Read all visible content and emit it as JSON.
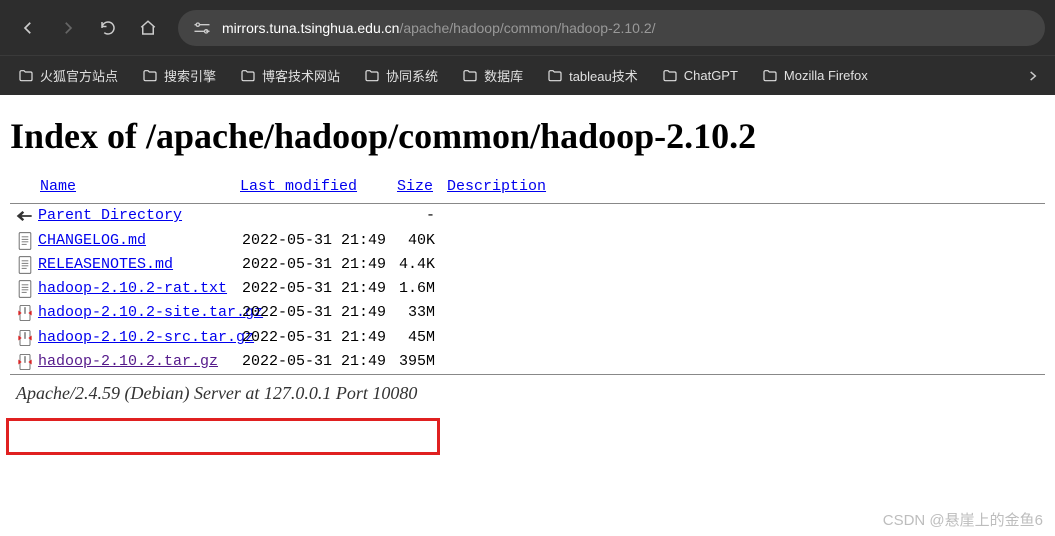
{
  "address": {
    "host": "mirrors.tuna.tsinghua.edu.cn",
    "path": "/apache/hadoop/common/hadoop-2.10.2/"
  },
  "bookmarks": [
    {
      "label": "火狐官方站点"
    },
    {
      "label": "搜索引擎"
    },
    {
      "label": "博客技术网站"
    },
    {
      "label": "协同系统"
    },
    {
      "label": "数据库"
    },
    {
      "label": "tableau技术"
    },
    {
      "label": "ChatGPT"
    },
    {
      "label": "Mozilla Firefox"
    }
  ],
  "heading": "Index of /apache/hadoop/common/hadoop-2.10.2",
  "columns": {
    "name": "Name",
    "modified": "Last modified",
    "size": "Size",
    "desc": "Description"
  },
  "parent": {
    "label": "Parent Directory",
    "size": "-"
  },
  "rows": [
    {
      "name": "CHANGELOG.md",
      "date": "2022-05-31 21:49",
      "size": "40K",
      "icon": "text",
      "visited": false
    },
    {
      "name": "RELEASENOTES.md",
      "date": "2022-05-31 21:49",
      "size": "4.4K",
      "icon": "text",
      "visited": false
    },
    {
      "name": "hadoop-2.10.2-rat.txt",
      "date": "2022-05-31 21:49",
      "size": "1.6M",
      "icon": "text",
      "visited": false
    },
    {
      "name": "hadoop-2.10.2-site.tar.gz",
      "date": "2022-05-31 21:49",
      "size": "33M",
      "icon": "archive",
      "visited": false
    },
    {
      "name": "hadoop-2.10.2-src.tar.gz",
      "date": "2022-05-31 21:49",
      "size": "45M",
      "icon": "archive",
      "visited": false
    },
    {
      "name": "hadoop-2.10.2.tar.gz",
      "date": "2022-05-31 21:49",
      "size": "395M",
      "icon": "archive",
      "visited": true
    }
  ],
  "footer": "Apache/2.4.59 (Debian) Server at 127.0.0.1 Port 10080",
  "watermark": "CSDN @悬崖上的金鱼6"
}
